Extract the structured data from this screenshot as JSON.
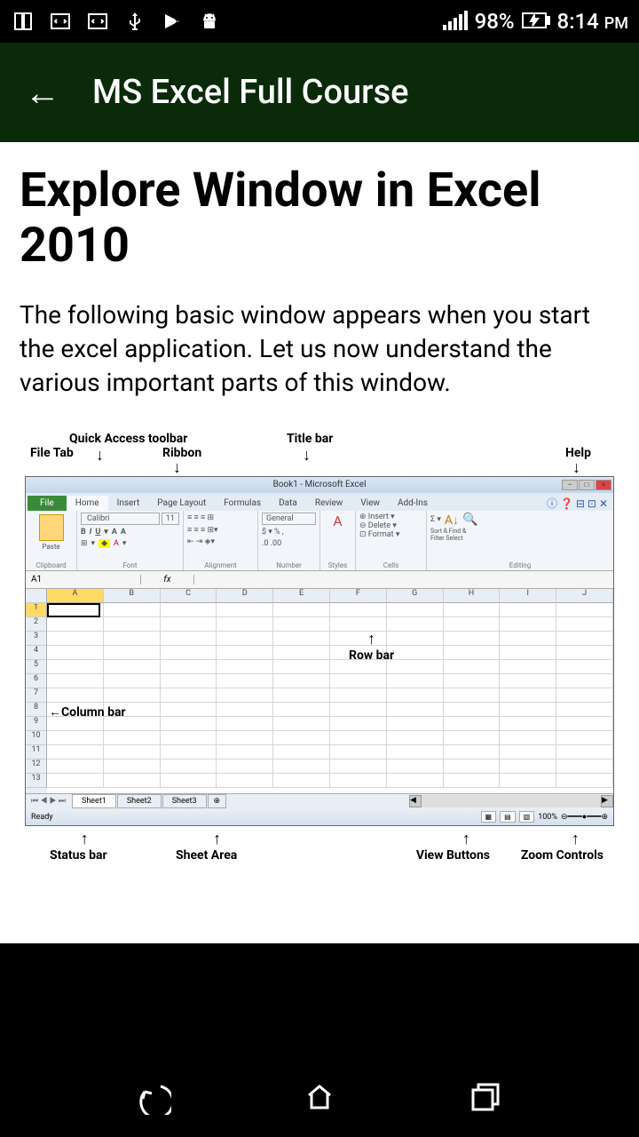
{
  "status": {
    "battery_pct": "98%",
    "time": "8:14",
    "ampm": "PM"
  },
  "header": {
    "title": "MS Excel Full Course"
  },
  "content": {
    "heading": "Explore Window in Excel 2010",
    "paragraph": "The following basic window appears when you start the excel application. Let us now understand the various important parts of this window."
  },
  "diagram": {
    "labels_top": {
      "file_tab": "File Tab",
      "quick_access": "Quick Access toolbar",
      "ribbon": "Ribbon",
      "title_bar": "Title bar",
      "help": "Help"
    },
    "labels_inline": {
      "row_bar": "Row bar",
      "column_bar": "Column bar"
    },
    "labels_bottom": {
      "status_bar": "Status bar",
      "sheet_area": "Sheet Area",
      "view_buttons": "View Buttons",
      "zoom_controls": "Zoom Controls"
    },
    "excel": {
      "title": "Book1 - Microsoft Excel",
      "file_tab": "File",
      "tabs": [
        "Home",
        "Insert",
        "Page Layout",
        "Formulas",
        "Data",
        "Review",
        "View",
        "Add-Ins"
      ],
      "ribbon_groups": {
        "g0": "Clipboard",
        "g1_font": "Calibri",
        "g1_size": "11",
        "g1": "Font",
        "g2": "Alignment",
        "g3_fmt": "General",
        "g3": "Number",
        "g4": "Styles",
        "g5_insert": "Insert",
        "g5_delete": "Delete",
        "g5_format": "Format",
        "g5": "Cells",
        "g6_sort": "Sort & Find &",
        "g6_filter": "Filter  Select",
        "g6": "Editing"
      },
      "name_box": "A1",
      "fx": "fx",
      "paste": "Paste",
      "columns": [
        "A",
        "B",
        "C",
        "D",
        "E",
        "F",
        "G",
        "H",
        "I",
        "J"
      ],
      "rows": [
        "1",
        "2",
        "3",
        "4",
        "5",
        "6",
        "7",
        "8",
        "9",
        "10",
        "11",
        "12",
        "13"
      ],
      "sheets": [
        "Sheet1",
        "Sheet2",
        "Sheet3"
      ],
      "status_ready": "Ready",
      "zoom": "100%"
    }
  }
}
